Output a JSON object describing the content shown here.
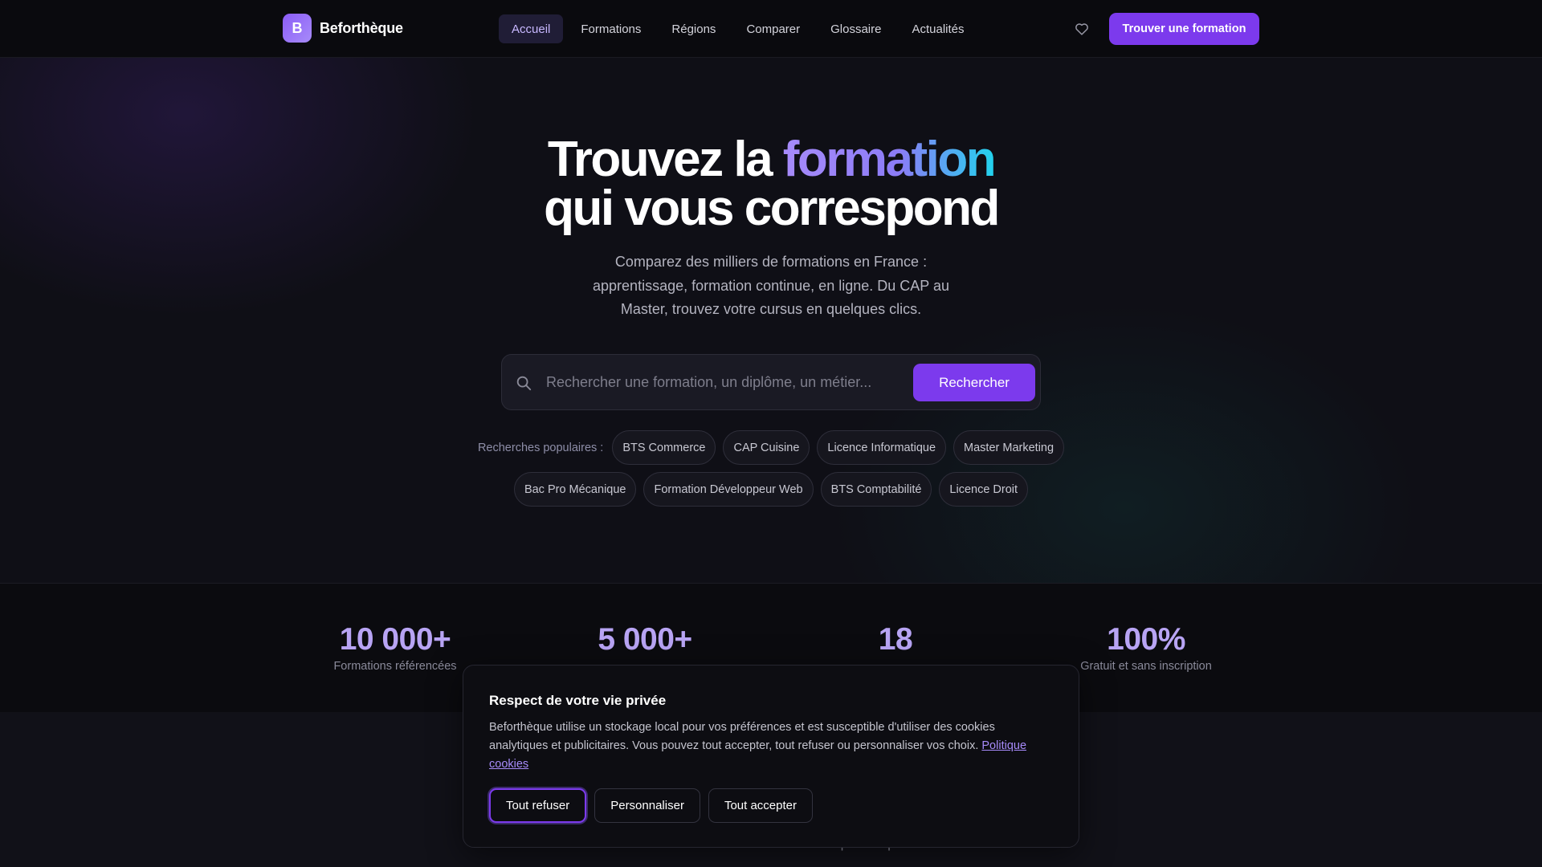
{
  "nav": {
    "logo_letter": "B",
    "logo_text": "Beforthèque",
    "links": [
      {
        "label": "Accueil",
        "active": true
      },
      {
        "label": "Formations",
        "active": false
      },
      {
        "label": "Régions",
        "active": false
      },
      {
        "label": "Comparer",
        "active": false
      },
      {
        "label": "Glossaire",
        "active": false
      },
      {
        "label": "Actualités",
        "active": false
      }
    ],
    "favorites_icon": "heart-icon",
    "cta_label": "Trouver une formation"
  },
  "hero": {
    "title_before": "Trouvez la ",
    "title_highlight": "formation",
    "title_line2": "qui vous correspond",
    "subtitle": "Comparez des milliers de formations en France : apprentissage, formation continue, en ligne. Du CAP au Master, trouvez votre cursus en quelques clics.",
    "search": {
      "icon": "search-icon",
      "placeholder": "Rechercher une formation, un diplôme, un métier...",
      "value": "",
      "button_label": "Rechercher"
    },
    "popular_label": "Recherches populaires :",
    "popular": [
      "BTS Commerce",
      "CAP Cuisine",
      "Licence Informatique",
      "Master Marketing",
      "Bac Pro Mécanique",
      "Formation Développeur Web",
      "BTS Comptabilité",
      "Licence Droit"
    ]
  },
  "stats": [
    {
      "value": "10 000+",
      "label": "Formations référencées"
    },
    {
      "value": "5 000+",
      "label": ""
    },
    {
      "value": "18",
      "label": ""
    },
    {
      "value": "100%",
      "label": "Gratuit et sans inscription"
    }
  ],
  "lower": {
    "subtitle": "Trouvez votre formation en trois étapes simples."
  },
  "cookie": {
    "title": "Respect de votre vie privée",
    "text": "Beforthèque utilise un stockage local pour vos préférences et est susceptible d'utiliser des cookies analytiques et publicitaires. Vous pouvez tout accepter, tout refuser ou personnaliser vos choix.",
    "link_label": "Politique cookies",
    "buttons": {
      "refuse": "Tout refuser",
      "customize": "Personnaliser",
      "accept": "Tout accepter"
    }
  },
  "colors": {
    "accent": "#7c3aed",
    "accent_light": "#a78bfa",
    "gradient_end": "#22d3ee",
    "background": "#0f0f16"
  }
}
